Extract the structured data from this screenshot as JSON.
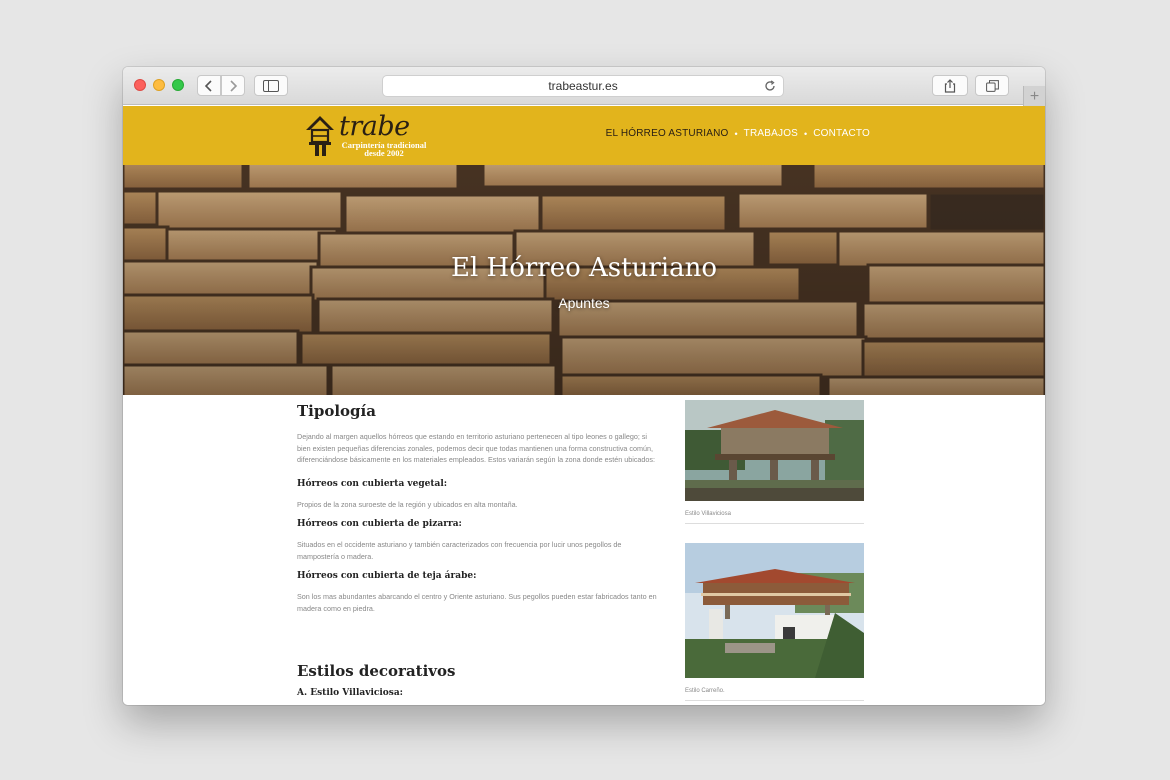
{
  "browser": {
    "url": "trabeastur.es",
    "new_tab_label": "+"
  },
  "site": {
    "logo_word": "TRABE",
    "logo_tagline_1": "Carpintería tradicional",
    "logo_tagline_2": "desde 2002",
    "accent_color": "#e2b41c",
    "nav": [
      {
        "label": "EL HÓRREO ASTURIANO",
        "active": true
      },
      {
        "label": "TRABAJOS",
        "active": false
      },
      {
        "label": "CONTACTO",
        "active": false
      }
    ],
    "nav_separator": "•"
  },
  "hero": {
    "title": "El Hórreo Asturiano",
    "subtitle": "Apuntes"
  },
  "article": {
    "section1_title": "Tipología",
    "intro": "Dejando al margen aquellos hórreos que estando en territorio asturiano pertenecen al tipo leones o gallego; si bien existen pequeñas diferencias zonales, podemos decir que todas mantienen una forma constructiva común, diferenciándose básicamente en los materiales empleados. Estos variarán según la zona donde estén ubicados:",
    "types": [
      {
        "heading": "Hórreos con cubierta vegetal:",
        "text": "Propios de la zona suroeste de la región y ubicados en alta montaña."
      },
      {
        "heading": "Hórreos con cubierta de pizarra:",
        "text": "Situados en el occidente asturiano y también caracterizados con frecuencia por lucir unos pegollos de mampostería o madera."
      },
      {
        "heading": "Hórreos con cubierta de teja árabe:",
        "text": "Son los mas abundantes abarcando el centro y Oriente asturiano. Sus pegollos pueden estar fabricados tanto en madera como en piedra."
      }
    ],
    "section2_title": "Estilos decorativos",
    "section2_first_item": "A. Estilo Villaviciosa:"
  },
  "sidebar": {
    "photos": [
      {
        "caption": "Estilo Villaviciosa"
      },
      {
        "caption": "Estilo Carreño."
      }
    ]
  }
}
